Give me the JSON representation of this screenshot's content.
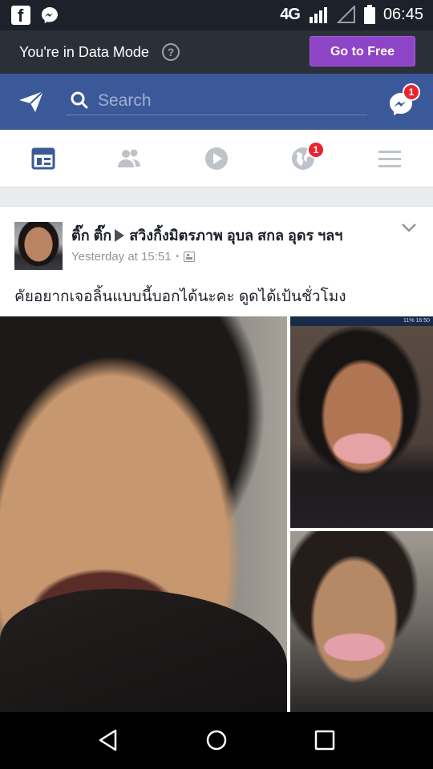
{
  "status_bar": {
    "network": "4G",
    "network_sup": "R4G",
    "time": "06:45",
    "icons": [
      "facebook-icon",
      "messenger-icon",
      "signal-icon",
      "battery-icon"
    ]
  },
  "data_mode": {
    "text": "You're in Data Mode",
    "help_glyph": "?",
    "button": "Go to Free",
    "button_color": "#8e44c6"
  },
  "header": {
    "search_placeholder": "Search",
    "messenger_badge": "1",
    "brand_color": "#3b5998"
  },
  "tabs": {
    "items": [
      "news-feed-tab",
      "friends-tab",
      "video-tab",
      "notifications-tab",
      "menu-tab"
    ],
    "notifications_badge": "1",
    "active": "news-feed-tab"
  },
  "post": {
    "author": "ติ๊ก ติ๊ก",
    "group": "สวิงกิ้งมิตรภาพ อุบล สกล อุดร ฯลฯ",
    "time": "Yesterday at 15:51",
    "dot": "•",
    "text": "คัยอยากเจอลิ้นแบบนี้บอกได้นะคะ ดูดได้เป้นชั่วโมง",
    "photo_status_strip": "11% 16:50"
  }
}
